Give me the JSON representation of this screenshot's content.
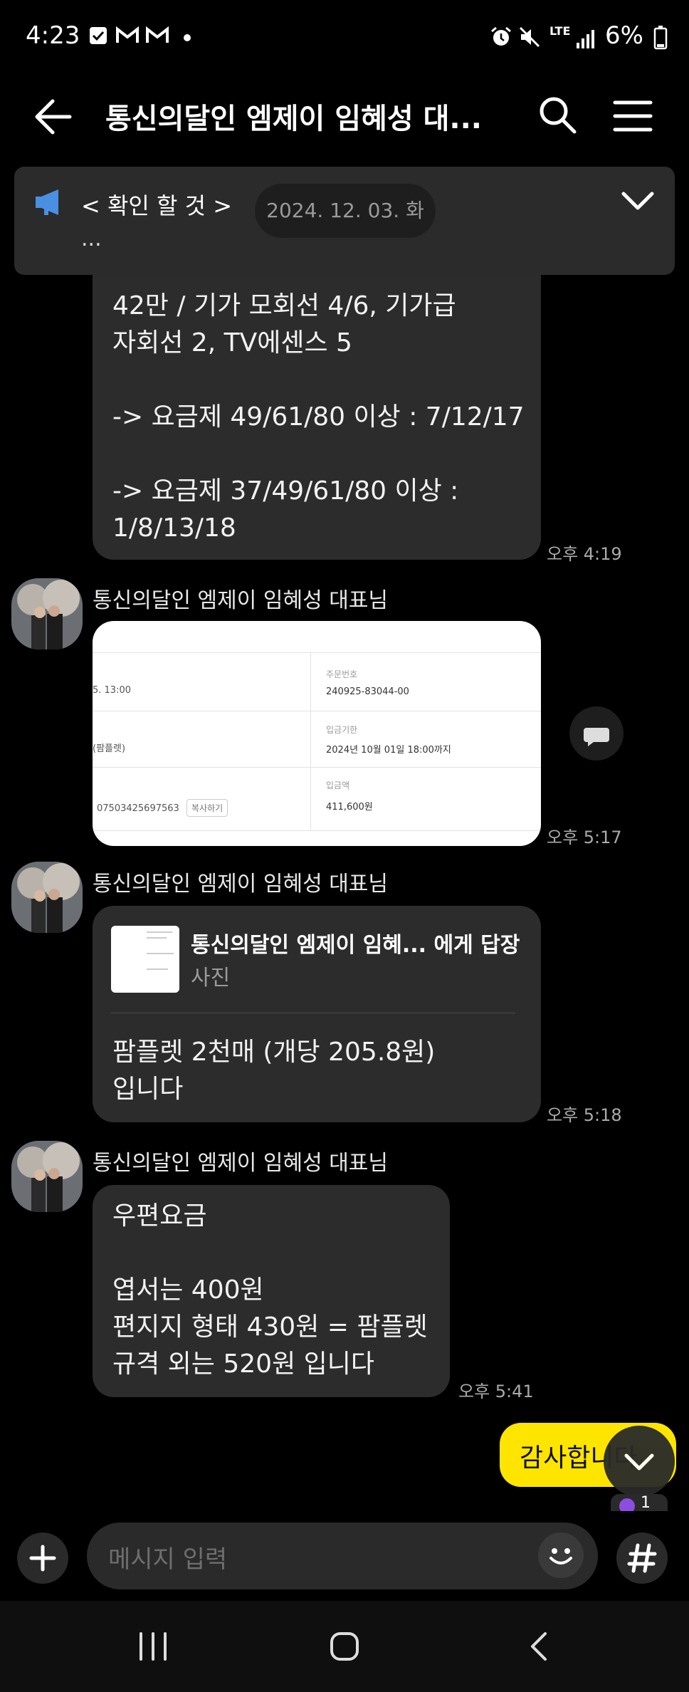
{
  "status_bar": {
    "time": "4:23",
    "network": "LTE",
    "battery": "6%"
  },
  "header": {
    "title": "통신의달인 엠제이 임혜성 대..."
  },
  "notice": {
    "title": "< 확인 할 것 >",
    "preview": "...",
    "date_pill": "2024. 12. 03. 화"
  },
  "messages": {
    "m1": {
      "text": "42만 / 기가 모회선 4/6, 기가급\n자회선 2, TV에센스 5\n\n-> 요금제 49/61/80 이상 : 7/12/17\n\n-> 요금제 37/49/61/80 이상 :\n1/8/13/18",
      "time": "오후 4:19"
    },
    "m2": {
      "sender": "통신의달인 엠제이 임혜성 대표님",
      "time": "오후 5:17",
      "image": {
        "row1_left": "5. 13:00",
        "row1_label": "주문번호",
        "row1_value": "240925-83044-00",
        "row2_left": "(팜플렛)",
        "row2_label": "입금기한",
        "row2_value": "2024년 10월 01일 18:00까지",
        "row3_left": "07503425697563",
        "row3_button": "복사하기",
        "row3_label": "입금액",
        "row3_value": "411,600원"
      }
    },
    "m3": {
      "sender": "통신의달인 엠제이 임혜성 대표님",
      "reply_to": "통신의달인 엠제이 임혜... 에게 답장",
      "reply_type": "사진",
      "text": "팜플렛 2천매 (개당 205.8원)\n입니다",
      "time": "오후 5:18"
    },
    "m4": {
      "sender": "통신의달인 엠제이 임혜성 대표님",
      "text": "우편요금\n\n엽서는 400원\n편지지 형태 430원 = 팜플렛\n규격 외는 520원 입니다",
      "time": "오후 5:41"
    },
    "m5": {
      "text": "감사합니다",
      "unread": "1"
    }
  },
  "input": {
    "placeholder": "메시지 입력"
  },
  "colors": {
    "my_bubble": "#fee500",
    "bubble": "#2c2c2c",
    "background": "#000000"
  }
}
